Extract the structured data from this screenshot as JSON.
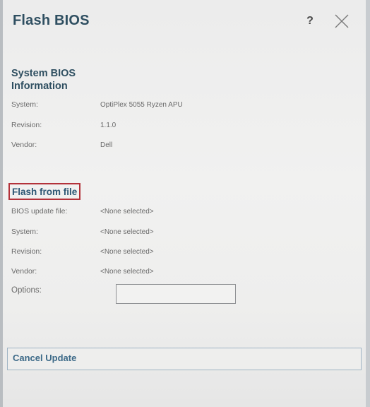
{
  "window": {
    "title": "Flash BIOS",
    "help_label": "?"
  },
  "system_bios": {
    "heading": "System BIOS Information",
    "rows": [
      {
        "label": "System:",
        "value": "OptiPlex 5055 Ryzen APU"
      },
      {
        "label": "Revision:",
        "value": "1.1.0"
      },
      {
        "label": "Vendor:",
        "value": "Dell"
      }
    ]
  },
  "flash_from_file": {
    "heading": "Flash from file",
    "rows": [
      {
        "label": "BIOS update file:",
        "value": "<None selected>"
      },
      {
        "label": "System:",
        "value": "<None selected>"
      },
      {
        "label": "Revision:",
        "value": "<None selected>"
      },
      {
        "label": "Vendor:",
        "value": "<None selected>"
      }
    ],
    "options_label": "Options:"
  },
  "footer": {
    "cancel_label": "Cancel Update"
  },
  "colors": {
    "heading": "#2f4f61",
    "highlight_border": "#b3323a",
    "cancel_text": "#3d6a88"
  },
  "icons": {
    "help": "question-mark-icon",
    "close": "close-x-icon"
  }
}
